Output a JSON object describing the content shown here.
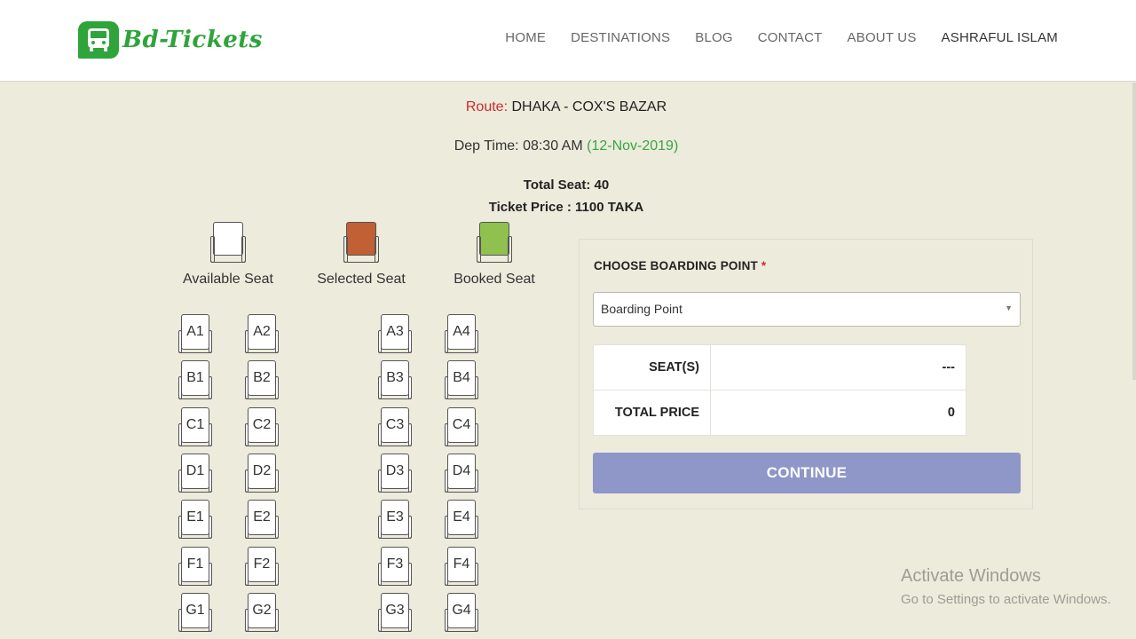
{
  "brand": {
    "name": "Bd-Tickets",
    "logo_icon": "bus-icon",
    "color": "#2ea43a"
  },
  "nav": [
    {
      "label": "HOME"
    },
    {
      "label": "DESTINATIONS"
    },
    {
      "label": "BLOG"
    },
    {
      "label": "CONTACT"
    },
    {
      "label": "ABOUT US"
    },
    {
      "label": "ASHRAFUL ISLAM"
    }
  ],
  "trip": {
    "route_label": "Route:",
    "route_value": "DHAKA - COX'S BAZAR",
    "dep_label": "Dep Time: 08:30 AM",
    "dep_date": "(12-Nov-2019)",
    "total_seat": "Total Seat: 40",
    "ticket_price": "Ticket Price : 1100 TAKA"
  },
  "legend": [
    {
      "label": "Available Seat",
      "color": "#ffffff"
    },
    {
      "label": "Selected Seat",
      "color": "#c15f35"
    },
    {
      "label": "Booked Seat",
      "color": "#90c04e"
    }
  ],
  "seats": {
    "rows": [
      [
        "A1",
        "A2",
        "A3",
        "A4"
      ],
      [
        "B1",
        "B2",
        "B3",
        "B4"
      ],
      [
        "C1",
        "C2",
        "C3",
        "C4"
      ],
      [
        "D1",
        "D2",
        "D3",
        "D4"
      ],
      [
        "E1",
        "E2",
        "E3",
        "E4"
      ],
      [
        "F1",
        "F2",
        "F3",
        "F4"
      ],
      [
        "G1",
        "G2",
        "G3",
        "G4"
      ]
    ]
  },
  "booking": {
    "title": "CHOOSE BOARDING POINT",
    "required_mark": "*",
    "select_value": "Boarding Point",
    "seats_label": "SEAT(S)",
    "seats_value": "---",
    "price_label": "TOTAL PRICE",
    "price_value": "0",
    "continue_label": "CONTINUE",
    "continue_color": "#8f96c8"
  },
  "watermark": {
    "line1": "Activate Windows",
    "line2": "Go to Settings to activate Windows."
  }
}
